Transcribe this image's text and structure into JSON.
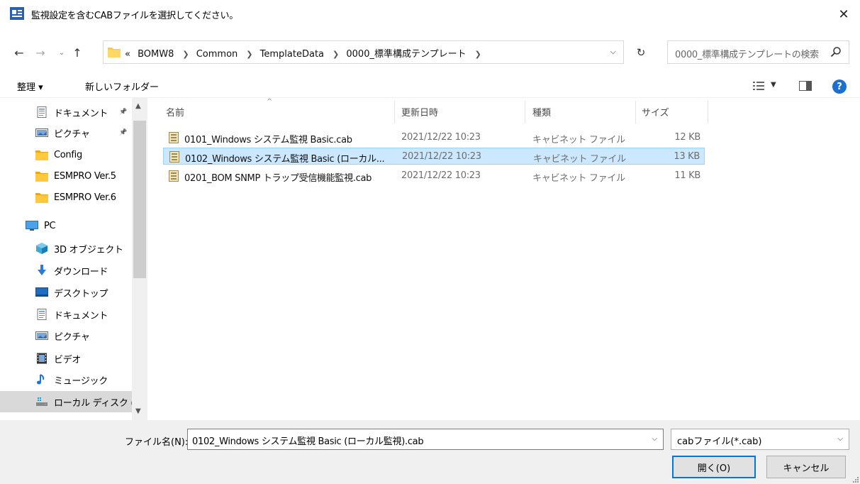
{
  "window": {
    "title": "監視設定を含むCABファイルを選択してください。",
    "close": "✕"
  },
  "nav": {
    "back": "←",
    "forward": "→",
    "recent": "⌄",
    "up": "↑",
    "breadcrumb": [
      "«",
      "BOMW8",
      "Common",
      "TemplateData",
      "0000_標準構成テンプレート"
    ],
    "refresh": "↻",
    "search_placeholder": "0000_標準構成テンプレートの検索"
  },
  "toolbar": {
    "organize": "整理 ▾",
    "new_folder": "新しいフォルダー"
  },
  "sidebar": {
    "items": [
      {
        "label": "ドキュメント",
        "icon": "document-icon",
        "pinned": true
      },
      {
        "label": "ピクチャ",
        "icon": "pictures-icon",
        "pinned": true
      },
      {
        "label": "Config",
        "icon": "folder-icon"
      },
      {
        "label": "ESMPRO Ver.5",
        "icon": "folder-icon"
      },
      {
        "label": "ESMPRO Ver.6",
        "icon": "folder-icon"
      },
      {
        "label": "PC",
        "icon": "pc-icon"
      },
      {
        "label": "3D オブジェクト",
        "icon": "3d-objects-icon"
      },
      {
        "label": "ダウンロード",
        "icon": "download-icon"
      },
      {
        "label": "デスクトップ",
        "icon": "desktop-icon"
      },
      {
        "label": "ドキュメント",
        "icon": "document-icon"
      },
      {
        "label": "ピクチャ",
        "icon": "pictures-icon"
      },
      {
        "label": "ビデオ",
        "icon": "video-icon"
      },
      {
        "label": "ミュージック",
        "icon": "music-icon"
      },
      {
        "label": "ローカル ディスク (C",
        "icon": "local-disk-icon",
        "selected": true
      }
    ]
  },
  "columns": {
    "name": "名前",
    "date": "更新日時",
    "type": "種類",
    "size": "サイズ"
  },
  "files": [
    {
      "name": "0101_Windows システム監視 Basic.cab",
      "date": "2021/12/22 10:23",
      "type": "キャビネット ファイル",
      "size": "12 KB"
    },
    {
      "name": "0102_Windows システム監視 Basic (ローカル...",
      "date": "2021/12/22 10:23",
      "type": "キャビネット ファイル",
      "size": "13 KB",
      "selected": true
    },
    {
      "name": "0201_BOM SNMP トラップ受信機能監視.cab",
      "date": "2021/12/22 10:23",
      "type": "キャビネット ファイル",
      "size": "11 KB"
    }
  ],
  "footer": {
    "filename_label": "ファイル名(N):",
    "filename_value": "0102_Windows システム監視 Basic (ローカル監視).cab",
    "filetype_value": "cabファイル(*.cab)",
    "open_button": "開く(O)",
    "cancel_button": "キャンセル"
  },
  "colors": {
    "selection_bg": "#cce8ff",
    "selection_border": "#99d1ff",
    "accent": "#0078d7",
    "folder": "#ffc83d"
  }
}
